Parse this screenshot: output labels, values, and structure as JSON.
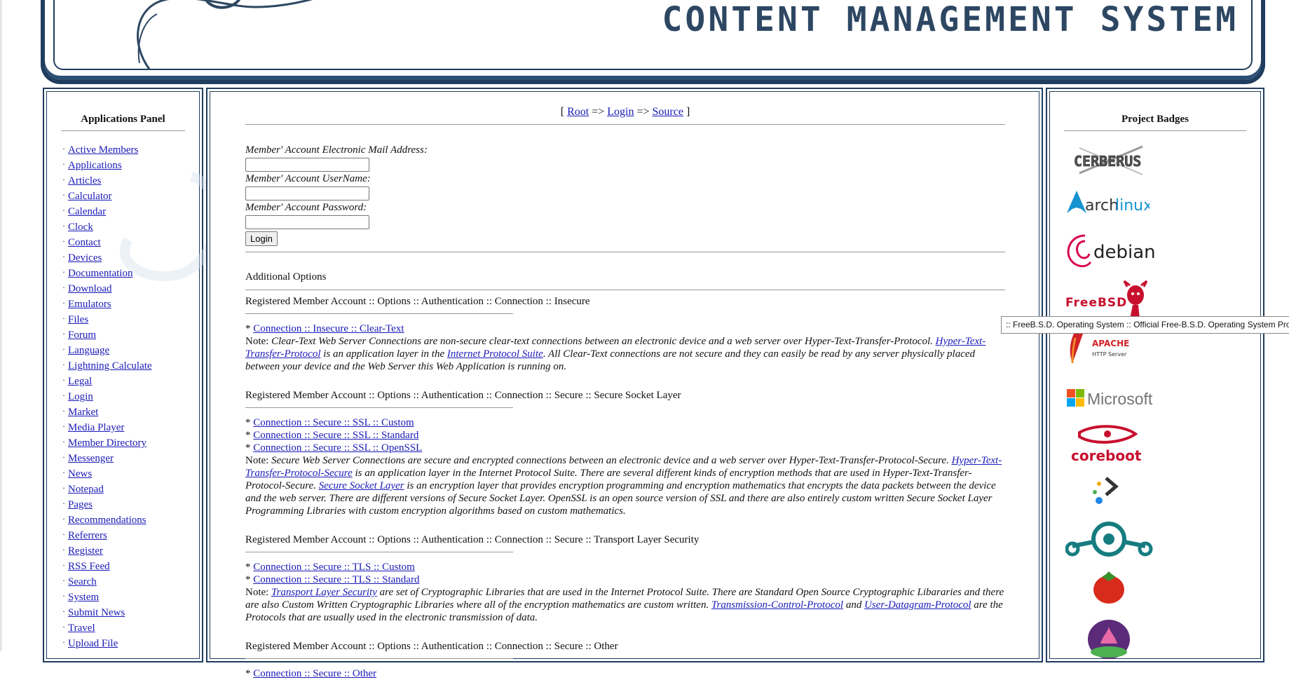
{
  "header": {
    "title": "CONTENT MANAGEMENT SYSTEM"
  },
  "left_panel": {
    "title": "Applications Panel",
    "items": [
      "Active Members",
      "Applications",
      "Articles",
      "Calculator",
      "Calendar",
      "Clock",
      "Contact",
      "Devices",
      "Documentation",
      "Download",
      "Emulators",
      "Files",
      "Forum",
      "Language",
      "Lightning Calculate",
      "Legal",
      "Login",
      "Market",
      "Media Player",
      "Member Directory",
      "Messenger",
      "News",
      "Notepad",
      "Pages",
      "Recommendations",
      "Referrers",
      "Register",
      "RSS Feed",
      "Search",
      "System",
      "Submit News",
      "Travel",
      "Upload File"
    ]
  },
  "breadcrumb": {
    "open": "[",
    "root": "Root",
    "arrow1": "=>",
    "login": "Login",
    "arrow2": "=>",
    "source": "Source",
    "close": "]"
  },
  "login_form": {
    "email_label": "Member' Account Electronic Mail Address:",
    "username_label": "Member' Account UserName:",
    "password_label": "Member' Account Password:",
    "email_value": "",
    "username_value": "",
    "password_value": "",
    "login_button": "Login"
  },
  "additional_options": {
    "title": "Additional Options",
    "sections": [
      {
        "heading": "Registered Member Account :: Options :: Authentication :: Connection :: Insecure",
        "links": [
          "Connection :: Insecure :: Clear-Text"
        ],
        "note_prefix": "Note: ",
        "note_a": "Clear-Text Web Server Connections are non-secure clear-text connections between an electronic device and a web server over Hyper-Text-Transfer-Protocol.",
        "note_link1": "Hyper-Text-Transfer-Protocol",
        "note_b": " is an application layer in the ",
        "note_link2": "Internet Protocol Suite",
        "note_c": ". All Clear-Text connections are not secure and they can easily be read by any server physically placed between your device and the Web Server this Web Application is running on."
      },
      {
        "heading": "Registered Member Account :: Options :: Authentication :: Connection :: Secure :: Secure Socket Layer",
        "links": [
          "Connection :: Secure :: SSL :: Custom",
          "Connection :: Secure :: SSL :: Standard",
          "Connection :: Secure :: SSL :: OpenSSL"
        ],
        "note_prefix": "Note: ",
        "note_a": "Secure Web Server Connections are secure and encrypted connections between an electronic device and a web server over Hyper-Text-Transfer-Protocol-Secure.",
        "note_link1": "Hyper-Text-Transfer-Protocol-Secure",
        "note_b": " is an application layer in the Internet Protocol Suite. There are several different kinds of encryption methods that are used in Hyper-Text-Transfer-Protocol-Secure. ",
        "note_link2": "Secure Socket Layer",
        "note_c": " is an encryption layer that provides encryption programming and encryption mathematics that encrypts the data packets between the device and the web server. There are different versions of Secure Socket Layer. OpenSSL is an open source version of SSL and there are also entirely custom written Secure Socket Layer Programming Libraries with custom encryption algorithms based on custom mathematics."
      },
      {
        "heading": "Registered Member Account :: Options :: Authentication :: Connection :: Secure :: Transport Layer Security",
        "links": [
          "Connection :: Secure :: TLS :: Custom",
          "Connection :: Secure :: TLS :: Standard"
        ],
        "note_prefix": "Note: ",
        "note_link0": "Transport Layer Security",
        "note_a": " are set of Cryptographic Libraries that are used in the Internet Protocol Suite. There are Standard Open Source Cryptographic Libararies and there are also Custom Written Cryptographic Libraries where all of the encryption mathematics are custom written. ",
        "note_link1": "Transmission-Control-Protocol",
        "note_b": " and ",
        "note_link2": "User-Datagram-Protocol",
        "note_c": " are the Protocols that are usually used in the electronic transmission of data."
      },
      {
        "heading": "Registered Member Account :: Options :: Authentication :: Connection :: Secure :: Other",
        "links": [
          "Connection :: Secure :: Other"
        ]
      }
    ]
  },
  "right_panel": {
    "title": "Project Badges",
    "badges": {
      "cerberus": "CERBERUS",
      "archlinux_a": "arch",
      "archlinux_b": "linux",
      "debian": "debian",
      "freebsd": "FreeBSD",
      "apache": "APACHE",
      "apache_sub": "HTTP Server",
      "microsoft": "Microsoft",
      "coreboot": "coreboot"
    }
  },
  "tooltip": ":: FreeB.S.D. Operating System :: Official Free-B.S.D. Operating System Project",
  "colors": {
    "frame": "#1f3d5e",
    "title": "#2d4763",
    "link": "#1a1ab8"
  }
}
